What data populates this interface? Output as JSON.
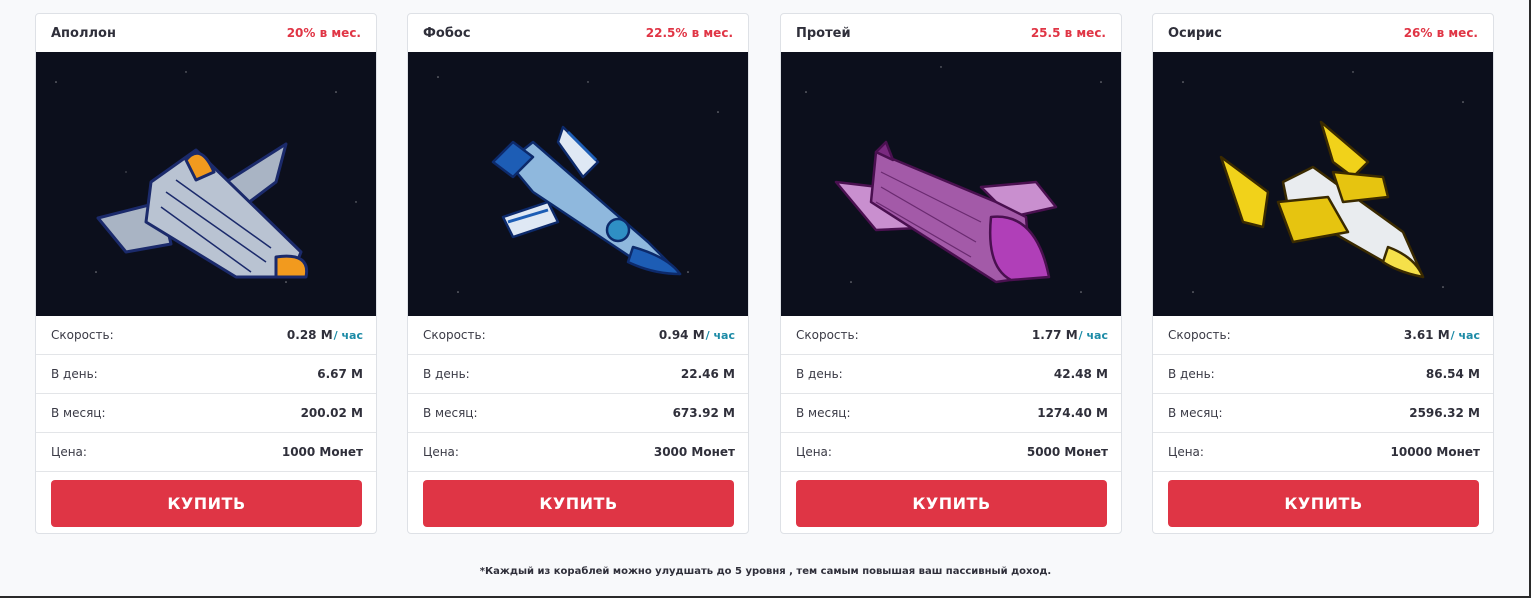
{
  "ships": [
    {
      "name": "Аполлон",
      "rate": "20% в мес.",
      "speed_label": "Скорость:",
      "speed_value": "0.28 М",
      "speed_unit": "/ час",
      "day_label": "В день:",
      "day_value": "6.67 М",
      "month_label": "В месяц:",
      "month_value": "200.02 М",
      "price_label": "Цена:",
      "price_value": "1000 Монет",
      "buy_label": "КУПИТЬ",
      "image": "apollo-ship-image"
    },
    {
      "name": "Фобос",
      "rate": "22.5% в мес.",
      "speed_label": "Скорость:",
      "speed_value": "0.94 М",
      "speed_unit": "/ час",
      "day_label": "В день:",
      "day_value": "22.46 М",
      "month_label": "В месяц:",
      "month_value": "673.92 М",
      "price_label": "Цена:",
      "price_value": "3000 Монет",
      "buy_label": "КУПИТЬ",
      "image": "phobos-ship-image"
    },
    {
      "name": "Протей",
      "rate": "25.5 в мес.",
      "speed_label": "Скорость:",
      "speed_value": "1.77 М",
      "speed_unit": "/ час",
      "day_label": "В день:",
      "day_value": "42.48 М",
      "month_label": "В месяц:",
      "month_value": "1274.40 М",
      "price_label": "Цена:",
      "price_value": "5000 Монет",
      "buy_label": "КУПИТЬ",
      "image": "proteus-ship-image"
    },
    {
      "name": "Осирис",
      "rate": "26% в мес.",
      "speed_label": "Скорость:",
      "speed_value": "3.61 М",
      "speed_unit": "/ час",
      "day_label": "В день:",
      "day_value": "86.54 М",
      "month_label": "В месяц:",
      "month_value": "2596.32 М",
      "price_label": "Цена:",
      "price_value": "10000 Монет",
      "buy_label": "КУПИТЬ",
      "image": "osiris-ship-image"
    }
  ],
  "footnote": "*Каждый из кораблей можно улудшать до 5 уровня , тем самым повышая ваш пассивный доход.",
  "colors": {
    "accent": "#df3545",
    "rate": "#e03545",
    "unit": "#1b8aa6",
    "space": "#0c0f1c"
  }
}
